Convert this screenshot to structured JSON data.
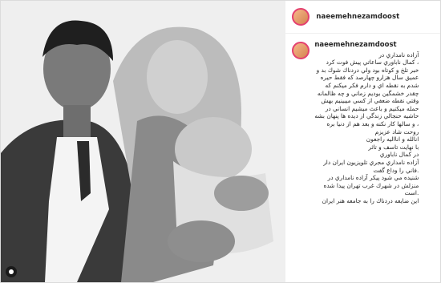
{
  "post": {
    "username": "naeemehnezamdoost",
    "caption_lines": [
      "آزاده نامداري در",
      "، كمال ناباوري ساعاتي پيش فوت كرد",
      "خبر تلخ و كوتاه بود ولي دردناك شوك بد و",
      "عميق سال هزارو چهارصد كه فقط حيره",
      "شدم به نقطه اي و دارم فكر ميكنم كه",
      "چقدر خشمگين بوديم زماني و چه ظالمانه",
      "وقتي نقطه ضعفي از كسي ميبينيم بهش",
      "حمله ميكنيم و باعث ميشيم انساني در",
      "حاشيه حنجالي زندگي از ديده ها پنهان بشه",
      "، و سالها كار نكنه و بعد هم از دنيا بره",
      "روحت شاد عزيزم",
      "انالله و اناالیه راجعون",
      "با نهايت تاسف و تاثر",
      "در كمال ناباوري",
      "آزاده نامداري مجري تلويزيون ايران دار",
      ".فاني را وداع گفت",
      "شنيده مي شود پيكر آزاده نامداري در",
      "منزلش در شهرك غرب تهران پيدا شده",
      ".است",
      "اين ضايعه دردناك را به جامعه هنر ايران"
    ]
  },
  "colors": {
    "accent_ring": "#e4406f",
    "text": "#262626",
    "border": "#dbdbdb"
  },
  "icons": {
    "photo_owner": "user-circle-icon"
  }
}
